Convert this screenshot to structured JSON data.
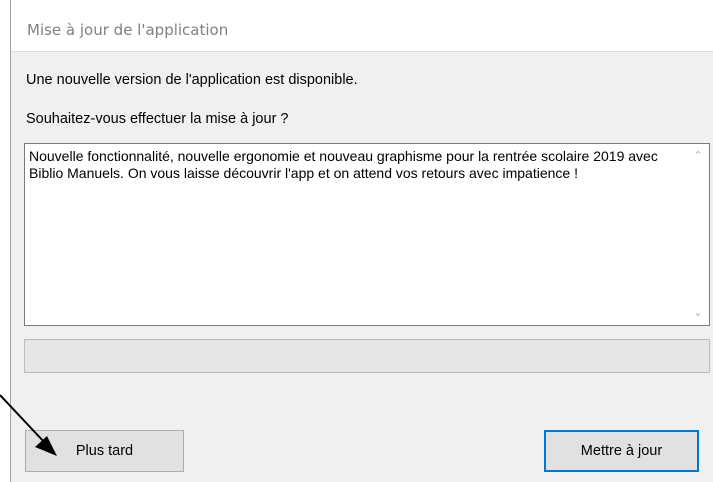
{
  "dialog": {
    "title": "Mise à jour de l'application",
    "message_line1": "Une nouvelle version de l'application est disponible.",
    "message_line2": "Souhaitez-vous effectuer la mise à jour ?",
    "release_notes": "Nouvelle fonctionnalité, nouvelle ergonomie et nouveau graphisme pour la rentrée scolaire 2019 avec Biblio Manuels. On vous laisse découvrir l'app et on attend vos retours avec impatience !",
    "scroll_up_icon": "chevron-up-icon",
    "scroll_down_icon": "chevron-down-icon",
    "progress_fraction": 0,
    "later_button_label": "Plus tard",
    "update_button_label": "Mettre à jour",
    "accent_color": "#0078d7"
  },
  "annotation": {
    "arrow_icon": "arrow-pointer-icon",
    "color": "#000000"
  }
}
